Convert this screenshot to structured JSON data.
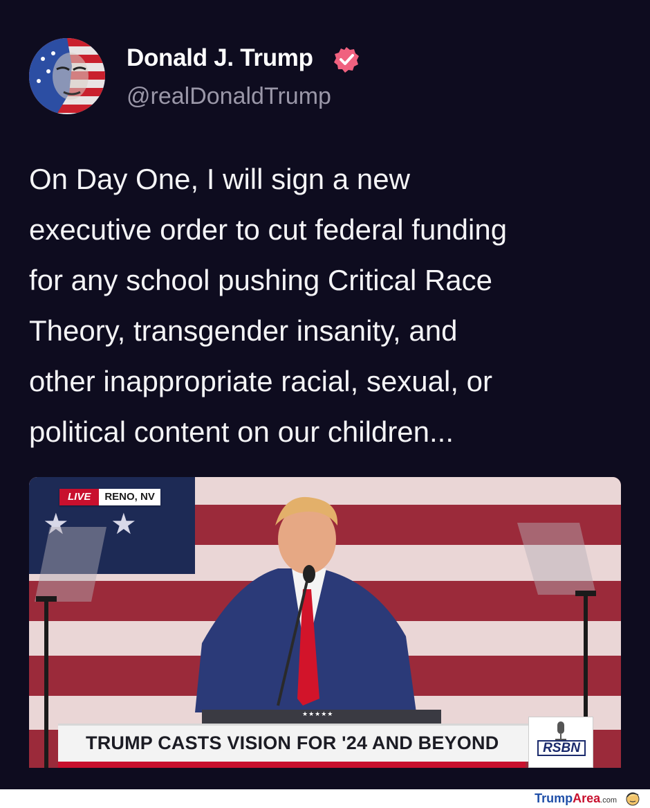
{
  "post": {
    "author_name": "Donald J. Trump",
    "handle": "@realDonaldTrump",
    "verified": true,
    "text": "On Day One, I will sign a new\nexecutive order to cut federal funding\nfor any school pushing Critical Race\nTheory, transgender insanity, and\nother inappropriate racial, sexual, or\npolitical content on our children..."
  },
  "media": {
    "live_label": "LIVE",
    "location": "RENO, NV",
    "headline": "TRUMP CASTS VISION FOR '24 AND BEYOND",
    "network_logo": "RSBN",
    "stars": "★★★★★"
  },
  "watermark": {
    "brand_part1": "Trump",
    "brand_part2": "Area",
    "tld": ".com"
  },
  "colors": {
    "background": "#0e0c1f",
    "verified_badge": "#f0617f",
    "live_red": "#c8102e"
  }
}
